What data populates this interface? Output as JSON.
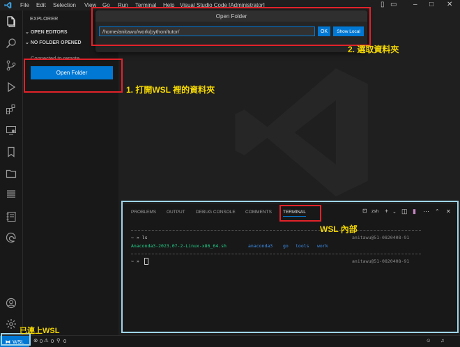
{
  "titlebar": {
    "menu": [
      "File",
      "Edit",
      "Selection",
      "View",
      "Go",
      "Run",
      "Terminal",
      "Help"
    ],
    "title": "Visual Studio Code [Administrator]"
  },
  "sidebar": {
    "header": "EXPLORER",
    "open_editors": "OPEN EDITORS",
    "no_folder": "NO FOLDER OPENED",
    "connected_note": "Connected to remote.",
    "open_folder_button": "Open Folder"
  },
  "quick_pick": {
    "title": "Open Folder",
    "input_value": "/home/anitawu/work/python/tutor/",
    "ok_label": "OK",
    "show_local_label": "Show Local",
    "item": ".."
  },
  "annotations": {
    "step1": "1. 打開WSL 裡的資料夾",
    "step2": "2. 選取資料夾",
    "wsl_inside": "WSL 內部",
    "connected": "已連上WSL"
  },
  "panel": {
    "tabs": [
      "PROBLEMS",
      "OUTPUT",
      "DEBUG CONSOLE",
      "COMMENTS",
      "TERMINAL"
    ],
    "shell": "zsh",
    "terminal": {
      "prompt1": "~ » ls",
      "host1": "anitawu@51-0820408-91",
      "ls_file": "Anaconda3-2023.07-2-Linux-x86_64.sh",
      "ls_dirs": [
        "anaconda3",
        "go",
        "tools",
        "work"
      ],
      "prompt2": "~ »",
      "host2": "anitawu@51-0820408-91"
    }
  },
  "statusbar": {
    "remote": "WSL",
    "errors": "0",
    "warnings": "0",
    "ports": "0"
  },
  "colors": {
    "accent": "#0078d4",
    "annotation_red": "#e2222a",
    "annotation_yellow": "#f5d800",
    "annotation_cyan": "#9fd5ea",
    "ls_file_green": "#23d18b",
    "ls_dir_blue": "#3b8eea"
  }
}
